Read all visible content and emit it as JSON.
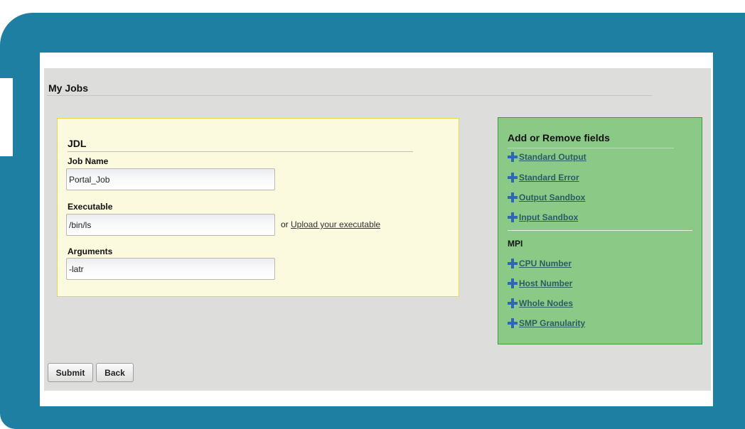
{
  "page": {
    "title": "My Jobs"
  },
  "jdl": {
    "title": "JDL",
    "job_name": {
      "label": "Job Name",
      "value": "Portal_Job"
    },
    "executable": {
      "label": "Executable",
      "value": "/bin/ls",
      "or_text": "or",
      "upload_link": "Upload your executable"
    },
    "arguments": {
      "label": "Arguments",
      "value": "-latr"
    }
  },
  "fields_panel": {
    "title": "Add or Remove fields",
    "items": [
      {
        "label": "Standard Output",
        "icon": "plus-icon"
      },
      {
        "label": "Standard Error",
        "icon": "plus-icon"
      },
      {
        "label": "Output Sandbox",
        "icon": "plus-icon"
      },
      {
        "label": "Input Sandbox",
        "icon": "plus-icon"
      }
    ],
    "mpi_title": "MPI",
    "mpi_items": [
      {
        "label": "CPU Number",
        "icon": "plus-icon"
      },
      {
        "label": "Host Number",
        "icon": "plus-icon"
      },
      {
        "label": "Whole Nodes",
        "icon": "plus-icon"
      },
      {
        "label": "SMP Granularity",
        "icon": "plus-icon"
      }
    ]
  },
  "buttons": {
    "submit": "Submit",
    "back": "Back"
  },
  "colors": {
    "frame": "#1f7fa3",
    "content_bg": "#dddddb",
    "jdl_box_bg": "#fbfadf",
    "jdl_box_border": "#e8d64a",
    "fields_box_bg": "#8aca86",
    "fields_box_border": "#3f9a3f",
    "plus_icon": "#2f67b8",
    "link_text": "#2a5c63"
  }
}
